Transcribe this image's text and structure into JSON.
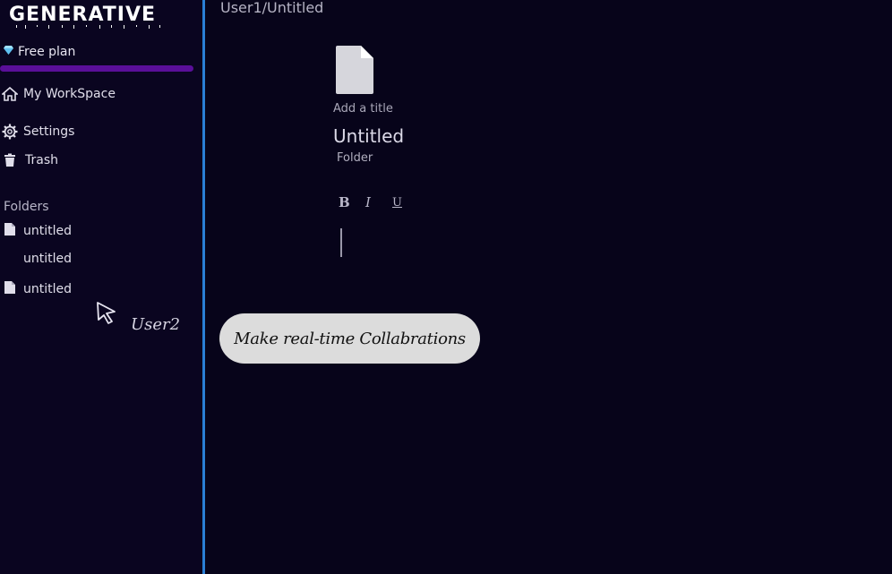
{
  "brand": {
    "logo_text": "GENERATIVE"
  },
  "plan": {
    "label": "Free plan",
    "icon": "diamond-icon",
    "accent": "#5a0f99"
  },
  "nav": [
    {
      "label": "My WorkSpace",
      "icon": "home-icon"
    },
    {
      "label": "Settings",
      "icon": "gear-icon"
    },
    {
      "label": "Trash",
      "icon": "trash-icon"
    }
  ],
  "folders": {
    "label": "Folders",
    "items": [
      {
        "label": "untitled",
        "icon": "file-icon"
      },
      {
        "label": "untitled",
        "icon": ""
      },
      {
        "label": "untitled",
        "icon": "file-icon"
      }
    ]
  },
  "collaborator": {
    "name": "User2"
  },
  "editor": {
    "breadcrumb": "User1/Untitled",
    "add_title_placeholder": "Add a title",
    "title": "Untitled",
    "folder_label": "Folder",
    "toolbar": {
      "bold": "B",
      "italic": "I",
      "underline": "U"
    }
  },
  "banner": {
    "text": "Make real-time Collabrations"
  },
  "colors": {
    "background": "#07041a",
    "sidebar": "#0a0520",
    "divider": "#2a7fd4"
  }
}
